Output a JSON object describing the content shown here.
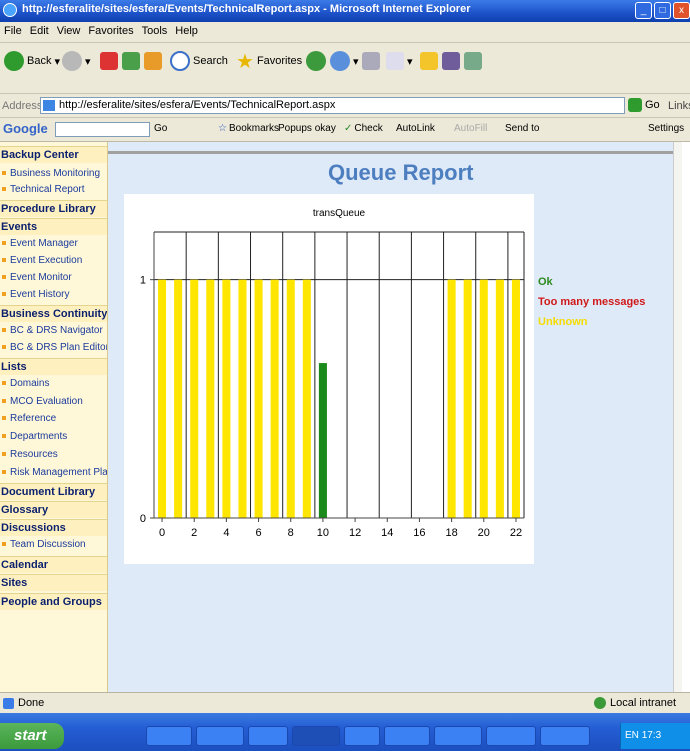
{
  "window": {
    "title": "http://esferalite/sites/esfera/Events/TechnicalReport.aspx - Microsoft Internet Explorer"
  },
  "menu": [
    "File",
    "Edit",
    "View",
    "Favorites",
    "Tools",
    "Help"
  ],
  "toolbar": {
    "back": "Back",
    "search": "Search",
    "favorites": "Favorites"
  },
  "address": {
    "label": "Address",
    "url": "http://esferalite/sites/esfera/Events/TechnicalReport.aspx",
    "go": "Go",
    "links": "Links"
  },
  "google_bar": {
    "logo": "Google",
    "go": "Go",
    "bookmarks": "Bookmarks",
    "popups": "Popups okay",
    "check": "Check",
    "autolink": "AutoLink",
    "autofill": "AutoFill",
    "sendto": "Send to",
    "settings": "Settings"
  },
  "sidebar": [
    {
      "label": "Backup Center",
      "type": "h"
    },
    {
      "label": "Business Monitoring",
      "type": "s"
    },
    {
      "label": "Technical Report",
      "type": "s"
    },
    {
      "label": "Procedure Library",
      "type": "h"
    },
    {
      "label": "Events",
      "type": "h"
    },
    {
      "label": "Event Manager",
      "type": "s"
    },
    {
      "label": "Event Execution",
      "type": "s"
    },
    {
      "label": "Event Monitor",
      "type": "s"
    },
    {
      "label": "Event History",
      "type": "s"
    },
    {
      "label": "Business Continuity",
      "type": "h"
    },
    {
      "label": "BC & DRS Navigator",
      "type": "s"
    },
    {
      "label": "BC & DRS Plan Editor",
      "type": "s"
    },
    {
      "label": "Lists",
      "type": "h"
    },
    {
      "label": "Domains",
      "type": "s"
    },
    {
      "label": "MCO Evaluation",
      "type": "s"
    },
    {
      "label": "Reference",
      "type": "s"
    },
    {
      "label": "Departments",
      "type": "s"
    },
    {
      "label": "Resources",
      "type": "s"
    },
    {
      "label": "Risk Management Plan",
      "type": "s"
    },
    {
      "label": "Document Library",
      "type": "h"
    },
    {
      "label": "Glossary",
      "type": "h"
    },
    {
      "label": "Discussions",
      "type": "h"
    },
    {
      "label": "Team Discussion",
      "type": "s"
    },
    {
      "label": "Calendar",
      "type": "h"
    },
    {
      "label": "Sites",
      "type": "h"
    },
    {
      "label": "People and Groups",
      "type": "h"
    }
  ],
  "report": {
    "title": "Queue Report"
  },
  "legend": [
    {
      "label": "Ok",
      "color": "#2a8a1e"
    },
    {
      "label": "Too many messages",
      "color": "#d01818"
    },
    {
      "label": "Unknown",
      "color": "#f5dc00"
    }
  ],
  "chart_data": {
    "type": "bar",
    "title": "transQueue",
    "x": [
      0,
      1,
      2,
      3,
      4,
      5,
      6,
      7,
      8,
      9,
      10,
      11,
      12,
      13,
      14,
      15,
      16,
      17,
      18,
      19,
      20,
      21,
      22
    ],
    "values": [
      1,
      1,
      1,
      1,
      1,
      1,
      1,
      1,
      1,
      1,
      0.65,
      0,
      0,
      0,
      0,
      0,
      0,
      0,
      1,
      1,
      1,
      1,
      1
    ],
    "statuses": [
      "Unknown",
      "Unknown",
      "Unknown",
      "Unknown",
      "Unknown",
      "Unknown",
      "Unknown",
      "Unknown",
      "Unknown",
      "Unknown",
      "Ok",
      "",
      "",
      "",
      "",
      "",
      "",
      "",
      "Unknown",
      "Unknown",
      "Unknown",
      "Unknown",
      "Unknown"
    ],
    "xticks": [
      0,
      2,
      4,
      6,
      8,
      10,
      12,
      14,
      16,
      18,
      20,
      22
    ],
    "yticks": [
      0,
      1
    ],
    "xlim": [
      -0.5,
      22.5
    ],
    "ylim": [
      0,
      1.2
    ],
    "colors": {
      "Unknown": "#ffe600",
      "Ok": "#1a8a1a"
    }
  },
  "status": {
    "text": "Done",
    "zone": "Local intranet"
  },
  "taskbar": {
    "start": "start",
    "clock": "17:3"
  }
}
